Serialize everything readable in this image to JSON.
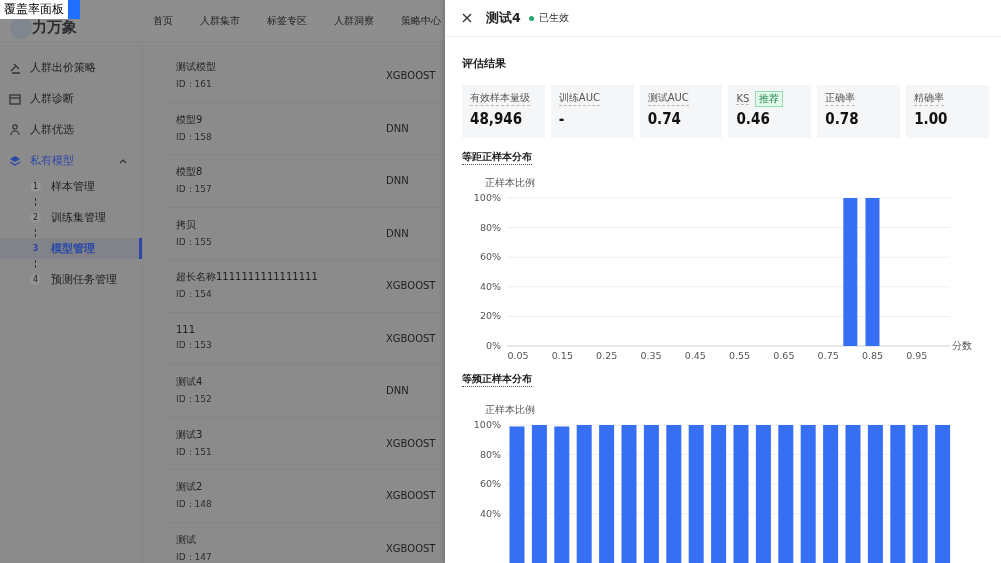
{
  "overlay_tag": {
    "label": "覆盖率面板"
  },
  "header": {
    "logo": "力万象",
    "nav": [
      "首页",
      "人群集市",
      "标签专区",
      "人群洞察",
      "策略中心"
    ]
  },
  "sidebar": {
    "items": [
      {
        "kind": "link",
        "label": "人群出价策略",
        "selected": false
      },
      {
        "kind": "link",
        "label": "人群诊断",
        "selected": false
      },
      {
        "kind": "link",
        "label": "人群优选",
        "selected": false
      },
      {
        "kind": "group",
        "label": "私有模型",
        "selected": true,
        "expanded": true,
        "children": [
          {
            "step": "1",
            "label": "样本管理",
            "selected": false
          },
          {
            "step": "2",
            "label": "训练集管理",
            "selected": false
          },
          {
            "step": "3",
            "label": "模型管理",
            "selected": true
          },
          {
            "step": "4",
            "label": "预测任务管理",
            "selected": false
          }
        ]
      }
    ]
  },
  "models": [
    {
      "name": "测试模型",
      "id": "ID：161",
      "type": "XGBOOST"
    },
    {
      "name": "模型9",
      "id": "ID：158",
      "type": "DNN"
    },
    {
      "name": "模型8",
      "id": "ID：157",
      "type": "DNN"
    },
    {
      "name": "拷贝",
      "id": "ID：155",
      "type": "DNN"
    },
    {
      "name": "超长名称1111111111111111",
      "id": "ID：154",
      "type": "XGBOOST"
    },
    {
      "name": "111",
      "id": "ID：153",
      "type": "XGBOOST"
    },
    {
      "name": "测试4",
      "id": "ID：152",
      "type": "DNN"
    },
    {
      "name": "测试3",
      "id": "ID：151",
      "type": "XGBOOST"
    },
    {
      "name": "测试2",
      "id": "ID：148",
      "type": "XGBOOST"
    },
    {
      "name": "测试",
      "id": "ID：147",
      "type": "XGBOOST"
    }
  ],
  "drawer": {
    "title": "测试4",
    "status": {
      "label": "已生效",
      "active": true
    },
    "section_title": "评估结果",
    "metrics": [
      {
        "label": "有效样本量级",
        "value": "48,946"
      },
      {
        "label": "训练AUC",
        "value": "-"
      },
      {
        "label": "测试AUC",
        "value": "0.74"
      },
      {
        "label": "KS",
        "value": "0.46",
        "badge": "推荐"
      },
      {
        "label": "正确率",
        "value": "0.78"
      },
      {
        "label": "精确率",
        "value": "1.00"
      }
    ],
    "charts": [
      {
        "title": "等距正样本分布",
        "chart_data": {
          "type": "bar",
          "xlabel": "分数",
          "ylabel": "正样本比例",
          "x": [
            0.05,
            0.1,
            0.15,
            0.2,
            0.25,
            0.3,
            0.35,
            0.4,
            0.45,
            0.5,
            0.55,
            0.6,
            0.65,
            0.7,
            0.75,
            0.8,
            0.85,
            0.9,
            0.95,
            1.0
          ],
          "series": [
            {
              "color": "#366ef4",
              "values": [
                0,
                0,
                0,
                0,
                0,
                0,
                0,
                0,
                0,
                0,
                0,
                0,
                0,
                0,
                0,
                1,
                1,
                0,
                0,
                0
              ]
            }
          ],
          "xlim": [
            0.025,
            1.025
          ],
          "grid": true,
          "ylim": [
            0,
            1
          ],
          "yticks": [
            {
              "value": 0,
              "label": "0%"
            },
            {
              "value": 0.2,
              "label": "20%"
            },
            {
              "value": 0.4,
              "label": "40%"
            },
            {
              "value": 0.6,
              "label": "60%"
            },
            {
              "value": 0.8,
              "label": "80%"
            },
            {
              "value": 1,
              "label": "100%"
            }
          ],
          "xticks": [
            {
              "value": 0.05,
              "label": "0.05"
            },
            {
              "value": 0.15,
              "label": "0.15"
            },
            {
              "value": 0.25,
              "label": "0.25"
            },
            {
              "value": 0.35,
              "label": "0.35"
            },
            {
              "value": 0.45,
              "label": "0.45"
            },
            {
              "value": 0.55,
              "label": "0.55"
            },
            {
              "value": 0.65,
              "label": "0.65"
            },
            {
              "value": 0.75,
              "label": "0.75"
            },
            {
              "value": 0.85,
              "label": "0.85"
            },
            {
              "value": 0.95,
              "label": "0.95"
            }
          ]
        }
      },
      {
        "title": "等频正样本分布",
        "chart_data": {
          "type": "bar",
          "ylabel": "正样本比例",
          "grid": true,
          "series": [
            {
              "color": "#366ef4",
              "values": [
                0.99,
                1,
                0.99,
                1,
                1,
                1,
                1,
                1,
                1,
                1,
                1,
                1,
                1,
                1,
                1,
                1,
                1,
                1,
                1,
                1
              ]
            }
          ],
          "ylim": [
            0,
            1
          ],
          "yticks": [
            {
              "value": 0.4,
              "label": "40%"
            },
            {
              "value": 0.6,
              "label": "60%"
            },
            {
              "value": 0.8,
              "label": "80%"
            },
            {
              "value": 1,
              "label": "100%"
            }
          ]
        }
      }
    ]
  }
}
